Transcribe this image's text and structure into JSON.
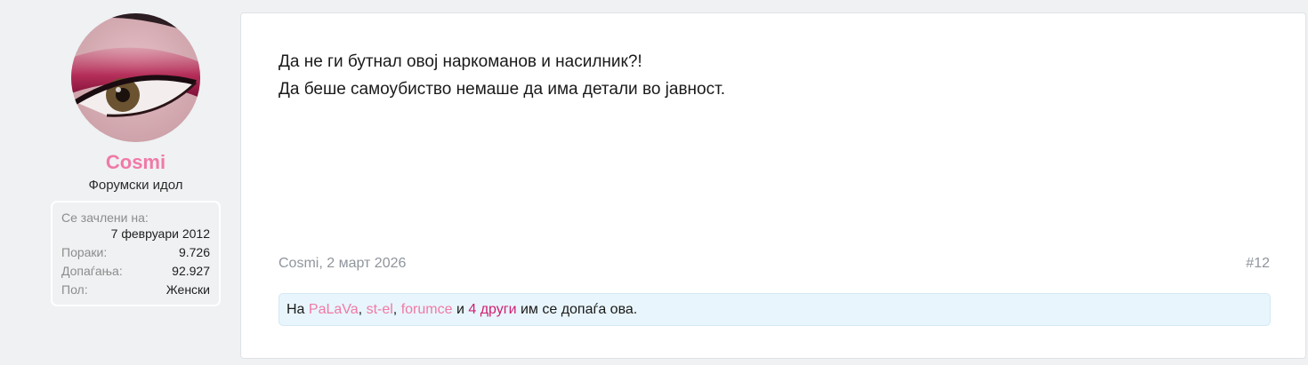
{
  "user": {
    "name": "Cosmi",
    "title": "Форумски идол",
    "name_color": "#f07aa6",
    "avatar_icon": "eye-makeup-avatar",
    "stats": [
      {
        "label": "Се зачлени на:",
        "value": "7 февруари 2012"
      },
      {
        "label": "Пораки:",
        "value": "9.726"
      },
      {
        "label": "Допаѓања:",
        "value": "92.927"
      },
      {
        "label": "Пол:",
        "value": "Женски"
      }
    ]
  },
  "post": {
    "lines": [
      "Да не ги бутнал овој наркоманов и насилник?!",
      "Да беше самоубиство немаше да има детали во јавност."
    ],
    "meta": "Cosmi, 2 март 2026",
    "number": "#12",
    "likes": {
      "prefix": "На",
      "users": [
        "PaLaVa",
        "st-el",
        "forumce"
      ],
      "separator": ",",
      "conjunction": "и",
      "others": "4 други",
      "suffix": "им се допаѓа ова."
    }
  },
  "colors": {
    "accent": "#f07aa6",
    "others_link": "#d01f72",
    "background": "#eff1f3",
    "likes_bg": "#e8f5fc"
  }
}
